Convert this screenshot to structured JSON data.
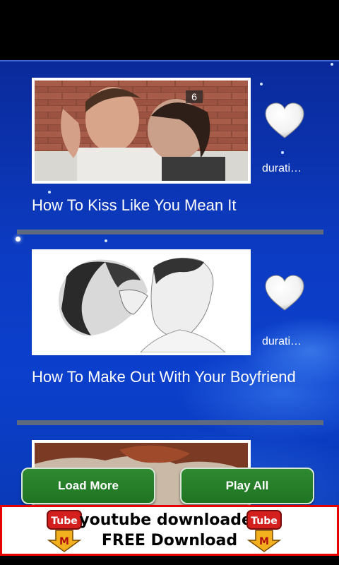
{
  "videos": [
    {
      "badge": "6",
      "title": "How To Kiss Like You Mean It",
      "duration": "durati…"
    },
    {
      "badge": "",
      "title": "How To Make Out With Your Boyfriend",
      "duration": "durati…"
    }
  ],
  "buttons": {
    "load_more": "Load More",
    "play_all": "Play All"
  },
  "ad": {
    "line1": "youtube downloader",
    "line2": "FREE Download",
    "logo_text_top": "Tube",
    "logo_text_bottom": "M"
  },
  "colors": {
    "background_blue": "#0c3cc4",
    "button_green": "#2f8a31",
    "ad_border": "#e60000",
    "divider": "#5d6a80"
  },
  "icons": {
    "favorite": "heart-icon"
  }
}
